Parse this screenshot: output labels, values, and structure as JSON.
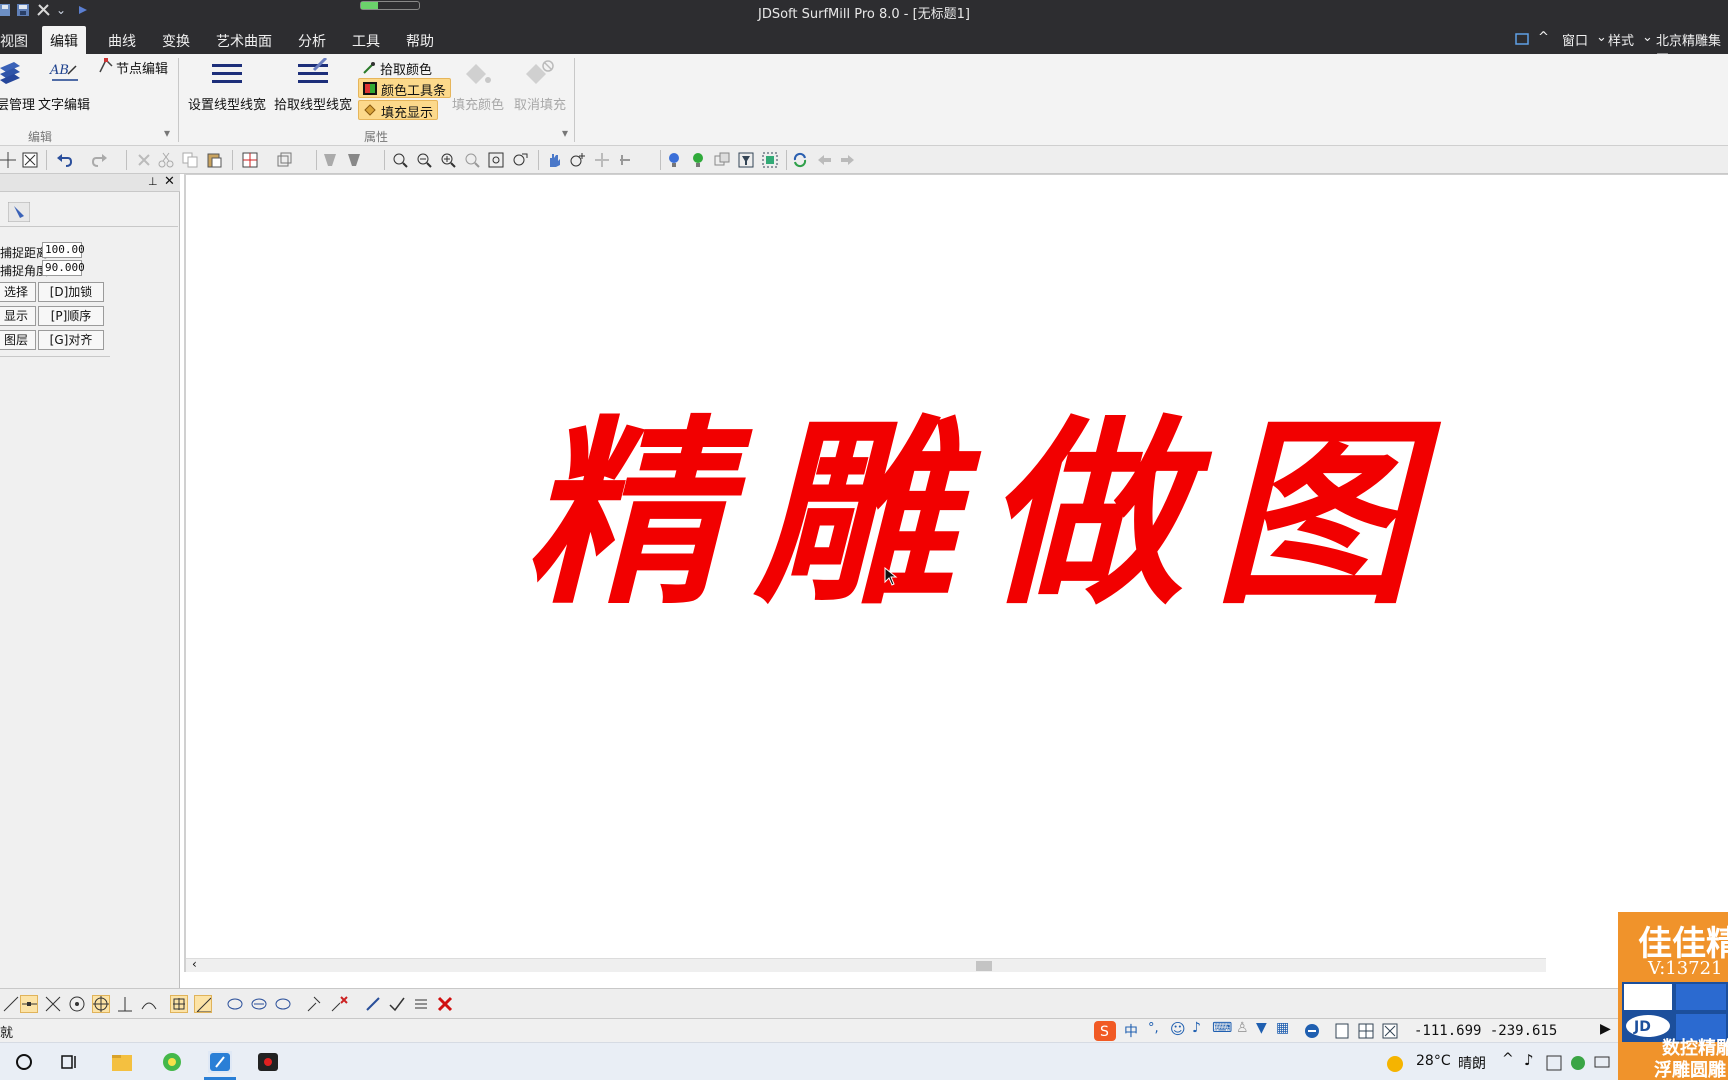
{
  "window": {
    "title": "JDSoft SurfMill Pro 8.0 - [无标题1]"
  },
  "menubar": {
    "tabs": [
      {
        "label": "视图"
      },
      {
        "label": "编辑"
      },
      {
        "label": "曲线"
      },
      {
        "label": "变换"
      },
      {
        "label": "艺术曲面"
      },
      {
        "label": "分析"
      },
      {
        "label": "工具"
      },
      {
        "label": "帮助"
      }
    ],
    "active_tab": "编辑",
    "right": {
      "window": "窗口",
      "style": "样式",
      "company": "北京精雕集团"
    }
  },
  "ribbon": {
    "edit_group": {
      "manage_label": "层管理",
      "text_edit_label": "文字编辑",
      "node_edit_label": "节点编辑",
      "caption": "编辑"
    },
    "property_group": {
      "set_line_label": "设置线型线宽",
      "pick_line_label": "拾取线型线宽",
      "pick_color_label": "拾取颜色",
      "color_toolbar_label": "颜色工具条",
      "fill_display_label": "填充显示",
      "fill_color_label": "填充颜色",
      "cancel_fill_label": "取消填充",
      "caption": "属性"
    }
  },
  "leftpanel": {
    "dist_label": "捕捉距离:",
    "dist_value": "100.00",
    "angle_label": "捕捉角度:",
    "angle_value": "90.000",
    "buttons": [
      "选择",
      "[D]加锁",
      "显示",
      "[P]顺序",
      "图层",
      "[G]对齐"
    ]
  },
  "canvas": {
    "text": "精雕做图",
    "text_color": "#f20000"
  },
  "status": {
    "left": "就",
    "coords": "-111.699 -239.615",
    "ime": "中"
  },
  "taskbar": {
    "weather_temp": "28°C",
    "weather_desc": "晴朗"
  },
  "ad": {
    "line1": "佳佳精",
    "line2": "V:13721",
    "line3": "数控精雕",
    "line4": "浮雕圆雕"
  },
  "icons": {
    "titlebar": [
      "save-icon",
      "floppy-icon",
      "tools-icon",
      "play-icon"
    ],
    "toolbar": [
      "snap-icon",
      "box-select-icon",
      "undo-icon",
      "redo-icon",
      "delete-icon",
      "cut-icon",
      "copy-icon",
      "paste-icon",
      "grid-icon",
      "view-cube-icon",
      "shade-icon",
      "zoom-window-icon",
      "zoom-out-icon",
      "zoom-in-icon",
      "zoom-prev-icon",
      "zoom-all-icon",
      "zoom-dynamic-icon",
      "pan-hand-icon",
      "zoom-point-icon",
      "move-view-icon",
      "rotate-view-icon",
      "bulb-blue-icon",
      "bulb-green-icon",
      "layer-icon",
      "filter-icon",
      "select-all-icon",
      "refresh-icon",
      "back-arrow-icon",
      "forward-arrow-icon"
    ]
  }
}
